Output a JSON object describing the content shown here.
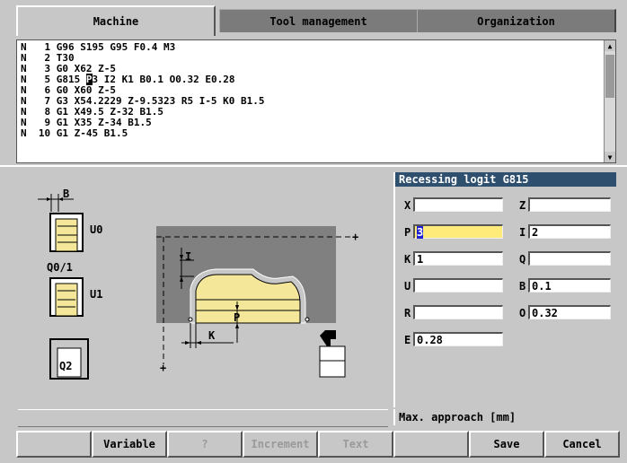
{
  "tabs": {
    "machine": "Machine",
    "tool_management": "Tool management",
    "organization": "Organization"
  },
  "program": {
    "lines": [
      {
        "n": "N",
        "num": " 1",
        "code": "G96 S195 G95 F0.4 M3"
      },
      {
        "n": "N",
        "num": " 2",
        "code": "T30"
      },
      {
        "n": "N",
        "num": " 3",
        "code": "G0 X62 Z-5"
      },
      {
        "n": "N",
        "num": " 5",
        "code_pre": "G815 ",
        "code_cursor": "P",
        "code_post": "3 I2 K1 B0.1 O0.32 E0.28"
      },
      {
        "n": "N",
        "num": " 6",
        "code": "G0 X60 Z-5"
      },
      {
        "n": "N",
        "num": " 7",
        "code": "G3 X54.2229 Z-9.5323 R5 I-5 K0 B1.5"
      },
      {
        "n": "N",
        "num": " 8",
        "code": "G1 X49.5 Z-32 B1.5"
      },
      {
        "n": "N",
        "num": " 9",
        "code": "G1 X35 Z-34 B1.5"
      },
      {
        "n": "N",
        "num": "10",
        "code": "G1 Z-45 B1.5"
      }
    ]
  },
  "graphic": {
    "labels": {
      "b": "B",
      "u0": "U0",
      "q01": "Q0/1",
      "u1": "U1",
      "q2": "Q2",
      "i": "I",
      "k": "K",
      "p": "P",
      "plus": "+"
    }
  },
  "form": {
    "title": "Recessing logit G815",
    "fields": {
      "x": {
        "label": "X",
        "value": ""
      },
      "z": {
        "label": "Z",
        "value": ""
      },
      "p": {
        "label": "P",
        "value": "3"
      },
      "i": {
        "label": "I",
        "value": "2"
      },
      "k": {
        "label": "K",
        "value": "1"
      },
      "q": {
        "label": "Q",
        "value": ""
      },
      "u": {
        "label": "U",
        "value": ""
      },
      "b": {
        "label": "B",
        "value": "0.1"
      },
      "r": {
        "label": "R",
        "value": ""
      },
      "o": {
        "label": "O",
        "value": "0.32"
      },
      "e": {
        "label": "E",
        "value": "0.28"
      }
    },
    "hint": "Max. approach [mm]"
  },
  "softkeys": {
    "variable": "Variable",
    "help": "?",
    "increment": "Increment",
    "text": "Text",
    "save": "Save",
    "cancel": "Cancel"
  },
  "colors": {
    "background": "#c7c7c7",
    "graphic_dark": "#808080",
    "workpiece_yellow": "#f4e79a",
    "title_bar": "#2f4f6f",
    "focus_field": "#ffeb7a"
  }
}
